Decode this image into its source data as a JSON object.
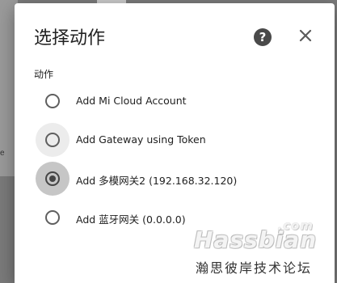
{
  "dialog": {
    "title": "选择动作",
    "help_symbol": "?",
    "section_label": "动作",
    "options": [
      {
        "label": "Add Mi Cloud Account",
        "selected": false
      },
      {
        "label": "Add Gateway using Token",
        "selected": false
      },
      {
        "label": "Add 多模网关2 (192.168.32.120)",
        "selected": true
      },
      {
        "label": "Add 蓝牙网关 (0.0.0.0)",
        "selected": false
      }
    ]
  },
  "backdrop": {
    "edge_glyph": "e"
  },
  "watermark": {
    "brand": "Hassbian",
    "tld": ".com",
    "slogan": "瀚思彼岸技术论坛"
  },
  "colors": {
    "radio": "#5f5f5f",
    "title": "#212121",
    "overlay": "#7a7a7a"
  },
  "icons": [
    "help-icon",
    "close-icon"
  ]
}
